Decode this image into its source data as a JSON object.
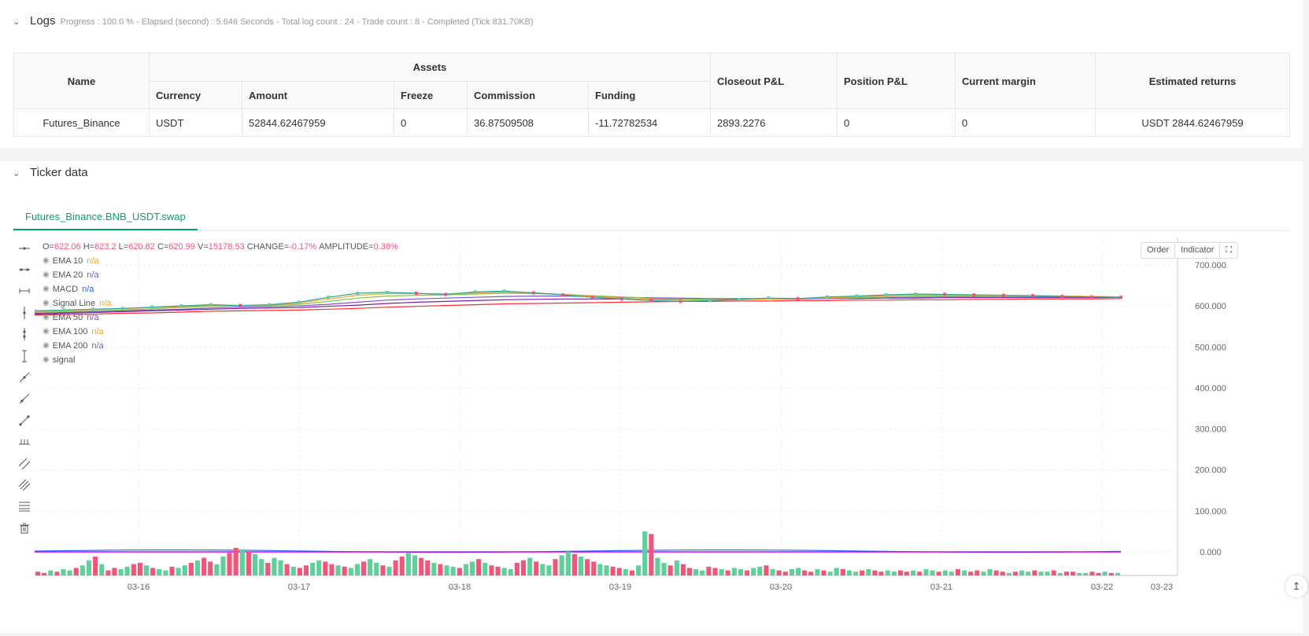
{
  "logs": {
    "title": "Logs",
    "meta": "Progress : 100.0 % - Elapsed (second) : 5.646  Seconds - Total log count : 24 - Trade count : 8 - Completed (Tick 831.70KB)"
  },
  "assets_table": {
    "headers": {
      "name": "Name",
      "assets": "Assets",
      "currency": "Currency",
      "amount": "Amount",
      "freeze": "Freeze",
      "commission": "Commission",
      "funding": "Funding",
      "closeout": "Closeout P&L",
      "position": "Position P&L",
      "margin": "Current margin",
      "returns": "Estimated returns"
    },
    "row": {
      "name": "Futures_Binance",
      "currency": "USDT",
      "amount": "52844.62467959",
      "freeze": "0",
      "commission": "36.87509508",
      "funding": "-11.72782534",
      "closeout": "2893.2276",
      "position": "0",
      "margin": "0",
      "returns": "USDT 2844.62467959"
    }
  },
  "ticker": {
    "title": "Ticker data",
    "tab": "Futures_Binance.BNB_USDT.swap",
    "buttons": {
      "order": "Order",
      "indicator": "Indicator"
    }
  },
  "ohlc": {
    "o_label": "O=",
    "o": "622.06",
    "h_label": "H=",
    "h": "623.2",
    "l_label": "L=",
    "l": "620.82",
    "c_label": "C=",
    "c": "620.99",
    "v_label": "V=",
    "v": "15178.53",
    "change_label": "CHANGE=",
    "change": "-0.17%",
    "amp_label": "AMPLITUDE=",
    "amp": "0.38%"
  },
  "legend": [
    {
      "name": "EMA 10",
      "value": "n/a",
      "color": "#f5a623"
    },
    {
      "name": "EMA 20",
      "value": "n/a",
      "color": "#7e57c2"
    },
    {
      "name": "MACD",
      "value": "n/a",
      "color": "#2962ff"
    },
    {
      "name": "Signal Line",
      "value": "n/a",
      "color": "#f5a623"
    },
    {
      "name": "EMA 50",
      "value": "n/a",
      "color": "#7e57c2"
    },
    {
      "name": "EMA 100",
      "value": "n/a",
      "color": "#f5a623"
    },
    {
      "name": "EMA 200",
      "value": "n/a",
      "color": "#7e57c2"
    },
    {
      "name": "signal",
      "value": "",
      "color": "#999999"
    }
  ],
  "colors": {
    "up": "#5fcf9e",
    "down": "#f2557a",
    "accent": "#0aa06e"
  },
  "chart_data": {
    "type": "line",
    "y_ticks": [
      "700.000",
      "600.000",
      "500.000",
      "400.000",
      "300.000",
      "200.000",
      "100.000",
      "0.000"
    ],
    "ylim": [
      0,
      760
    ],
    "x_ticks": [
      "03-16",
      "03-17",
      "03-18",
      "03-19",
      "03-20",
      "03-21",
      "03-22",
      "03-23"
    ],
    "price_close": [
      588,
      590,
      592,
      594,
      597,
      600,
      603,
      601,
      603,
      609,
      621,
      631,
      633,
      631,
      628,
      634,
      636,
      632,
      627,
      621,
      617,
      613,
      611,
      613,
      616,
      619,
      618,
      622,
      624,
      627,
      629,
      628,
      627,
      626,
      625,
      623,
      622,
      621
    ],
    "ema_fast": [
      586,
      589,
      591,
      593,
      596,
      598,
      601,
      601,
      602,
      607,
      617,
      626,
      630,
      630,
      629,
      632,
      634,
      632,
      628,
      623,
      619,
      616,
      614,
      614,
      615,
      617,
      618,
      620,
      622,
      625,
      627,
      627,
      627,
      626,
      625,
      624,
      623,
      622
    ],
    "ema_slow": [
      584,
      586,
      588,
      590,
      593,
      596,
      599,
      600,
      601,
      604,
      611,
      619,
      624,
      626,
      627,
      629,
      631,
      630,
      628,
      625,
      622,
      619,
      617,
      616,
      616,
      617,
      618,
      619,
      620,
      622,
      624,
      625,
      625,
      625,
      625,
      624,
      623,
      622
    ],
    "ema_50": [
      582,
      584,
      586,
      588,
      590,
      592,
      595,
      597,
      598,
      600,
      604,
      609,
      614,
      617,
      619,
      621,
      623,
      624,
      624,
      623,
      621,
      620,
      619,
      618,
      618,
      618,
      618,
      618,
      619,
      620,
      621,
      622,
      622,
      622,
      622,
      622,
      622,
      622
    ],
    "ema_100": [
      580,
      582,
      584,
      586,
      588,
      590,
      592,
      594,
      595,
      596,
      599,
      602,
      606,
      609,
      611,
      613,
      615,
      616,
      617,
      617,
      617,
      617,
      617,
      617,
      617,
      617,
      617,
      618,
      618,
      619,
      619,
      620,
      620,
      620,
      620,
      620,
      620,
      621
    ],
    "ema_200": [
      578,
      579,
      580,
      582,
      583,
      585,
      587,
      588,
      589,
      590,
      592,
      594,
      597,
      599,
      601,
      603,
      605,
      606,
      607,
      608,
      609,
      610,
      611,
      611,
      612,
      612,
      613,
      613,
      614,
      614,
      615,
      615,
      616,
      616,
      617,
      617,
      617,
      618
    ],
    "volume": [
      3,
      2,
      4,
      3,
      5,
      4,
      6,
      8,
      12,
      15,
      9,
      4,
      6,
      5,
      7,
      9,
      10,
      8,
      6,
      5,
      4,
      7,
      6,
      8,
      10,
      12,
      14,
      11,
      9,
      15,
      18,
      22,
      20,
      19,
      17,
      13,
      10,
      14,
      12,
      9,
      7,
      6,
      8,
      10,
      12,
      11,
      9,
      8,
      7,
      6,
      9,
      11,
      13,
      10,
      8,
      7,
      12,
      15,
      18,
      16,
      14,
      12,
      10,
      9,
      8,
      7,
      6,
      9,
      11,
      13,
      10,
      8,
      7,
      6,
      5,
      10,
      12,
      14,
      11,
      9,
      8,
      13,
      16,
      19,
      17,
      15,
      13,
      11,
      9,
      8,
      7,
      6,
      5,
      4,
      8,
      35,
      33,
      14,
      10,
      8,
      12,
      9,
      6,
      5,
      4,
      7,
      6,
      5,
      4,
      6,
      5,
      4,
      6,
      7,
      8,
      5,
      4,
      3,
      5,
      6,
      4,
      3,
      5,
      4,
      3,
      6,
      5,
      4,
      3,
      4,
      5,
      4,
      3,
      4,
      3,
      4,
      3,
      4,
      3,
      5,
      4,
      3,
      4,
      3,
      5,
      4,
      3,
      4,
      3,
      5,
      4,
      3,
      2,
      3,
      4,
      3,
      4,
      3,
      3,
      4,
      2,
      3,
      3,
      2,
      2,
      3,
      2,
      3,
      2,
      2
    ],
    "volume_dir": "alternating-up-down"
  }
}
